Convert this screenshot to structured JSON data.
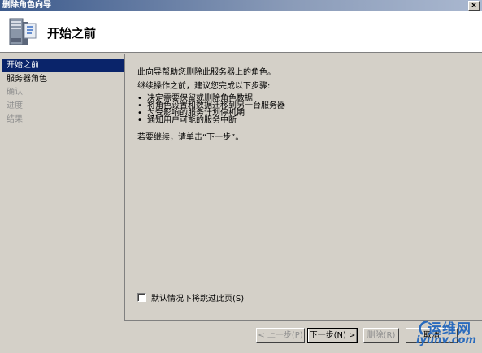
{
  "window": {
    "title": "删除角色向导",
    "close_label": "x"
  },
  "header": {
    "title": "开始之前"
  },
  "sidebar": {
    "items": [
      {
        "label": "开始之前",
        "state": "active"
      },
      {
        "label": "服务器角色",
        "state": "enabled"
      },
      {
        "label": "确认",
        "state": "disabled"
      },
      {
        "label": "进度",
        "state": "disabled"
      },
      {
        "label": "结果",
        "state": "disabled"
      }
    ]
  },
  "content": {
    "intro": "此向导帮助您删除此服务器上的角色。",
    "before_continue": "继续操作之前，建议您完成以下步骤:",
    "bullets": [
      "决定需要保留或删除角色数据",
      "将角色设置和数据迁移到另一台服务器",
      "为受影响的服务计划停机期",
      "通知用户可能的服务中断"
    ],
    "continue_hint": "若要继续，请单击“下一步”。",
    "skip_label": "默认情况下将跳过此页(S)"
  },
  "buttons": {
    "previous": "< 上一步(P)",
    "next": "下一步(N) >",
    "delete": "删除(R)",
    "cancel": "取消"
  },
  "watermark": {
    "top": "运维网",
    "bottom": "iyunv.com"
  },
  "colors": {
    "selected_bg": "#0a246a",
    "dialog_bg": "#d4d0c8",
    "watermark": "#2a6bbd"
  }
}
